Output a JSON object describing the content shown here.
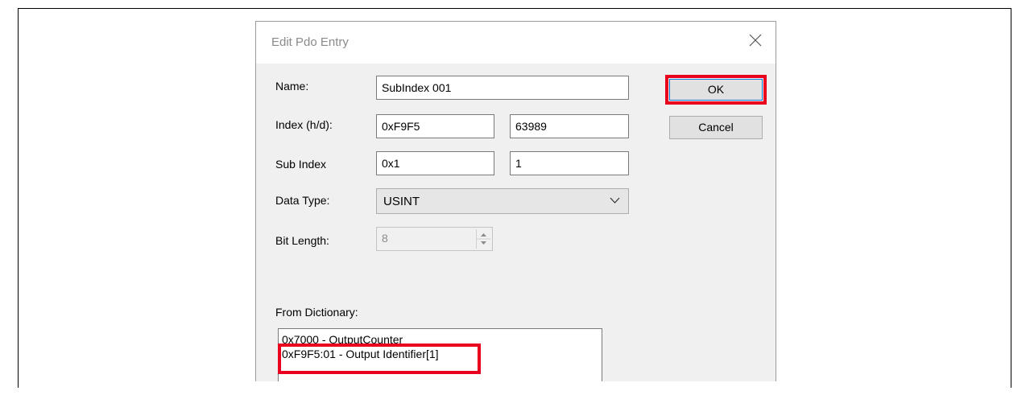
{
  "dialog": {
    "title": "Edit Pdo Entry",
    "close_icon": "close-icon"
  },
  "form": {
    "name_label": "Name:",
    "name_value": "SubIndex 001",
    "index_label": "Index (h/d):",
    "index_hex": "0xF9F5",
    "index_dec": "63989",
    "subindex_label": "Sub Index",
    "subindex_hex": "0x1",
    "subindex_dec": "1",
    "datatype_label": "Data Type:",
    "datatype_value": "USINT",
    "bitlength_label": "Bit Length:",
    "bitlength_value": "8",
    "dictionary_label": "From Dictionary:"
  },
  "buttons": {
    "ok": "OK",
    "cancel": "Cancel"
  },
  "dictionary": {
    "items": [
      "0x7000 - OutputCounter",
      "0xF9F5:01 - Output Identifier[1]"
    ]
  },
  "colors": {
    "highlight": "#e8001c",
    "dialog_bg": "#f0f0f0"
  }
}
